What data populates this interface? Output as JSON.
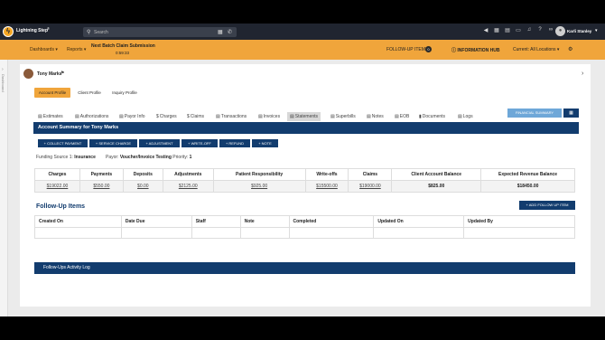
{
  "topbar": {
    "brand": "Lightning Step",
    "brand_mark": "®",
    "search": {
      "placeholder": "Search"
    },
    "user_name": "Karli Stanley"
  },
  "navbar": {
    "dashboards": "Dashboards",
    "reports": "Reports",
    "batch_title": "Next Batch Claim Submission",
    "batch_time": "0:59:33",
    "follow_up": "FOLLOW-UP ITEMS",
    "follow_up_count": "0",
    "info_hub": "INFORMATION HUB",
    "location": "Current: All Locations"
  },
  "siderail": {
    "label": "Dashboard"
  },
  "patient": {
    "name": "Tony Marks"
  },
  "profile_tabs": [
    {
      "label": "Account Profile"
    },
    {
      "label": "Client Profile"
    },
    {
      "label": "Inquiry Profile"
    }
  ],
  "financial_summary": "FINANCIAL SUMMARY",
  "section_tabs": [
    {
      "label": "Estimates"
    },
    {
      "label": "Authorizations"
    },
    {
      "label": "Payor Info"
    },
    {
      "label": "Charges"
    },
    {
      "label": "Claims"
    },
    {
      "label": "Transactions"
    },
    {
      "label": "Invoices"
    },
    {
      "label": "Statements"
    },
    {
      "label": "Superbills"
    },
    {
      "label": "Notes"
    },
    {
      "label": "EOB"
    },
    {
      "label": "Documents"
    },
    {
      "label": "Logs"
    }
  ],
  "account_summary_title": "Account Summary for Tony Marks",
  "actions": [
    {
      "label": "+ COLLECT PAYMENT"
    },
    {
      "label": "+ SERVICE CHARGE"
    },
    {
      "label": "+ ADJUSTMENT"
    },
    {
      "label": "+ WRITE-OFF"
    },
    {
      "label": "+ REFUND"
    },
    {
      "label": "+ NOTE"
    }
  ],
  "funding": {
    "source_label": "Funding Source 1:",
    "source_value": "Insurance",
    "payor_label": "Payor:",
    "payor_value": "Voucher/Invoice Testing",
    "priority_label": "Priority:",
    "priority_value": "1"
  },
  "summary_table": {
    "headers": [
      "Charges",
      "Payments",
      "Deposits",
      "Adjustments",
      "Patient Responsibility",
      "Write-offs",
      "Claims",
      "Client Account Balance",
      "Expected Revenue Balance"
    ],
    "row": [
      "$19022.00",
      "$550.00",
      "$0.00",
      "$2125.00",
      "$925.00",
      "$15500.00",
      "$19000.00",
      "$825.00",
      "$18450.00"
    ]
  },
  "follow_up": {
    "title": "Follow-Up Items",
    "add_label": "+ ADD FOLLOW UP ITEM",
    "headers": [
      "Created On",
      "Date Due",
      "Staff",
      "Note",
      "Completed",
      "Updated On",
      "Updated By"
    ]
  },
  "activity_log": "Follow-Ups Activity Log",
  "colors": {
    "accent": "#f0a53b",
    "navy": "#123c6e",
    "light_blue": "#6ea7d8"
  }
}
